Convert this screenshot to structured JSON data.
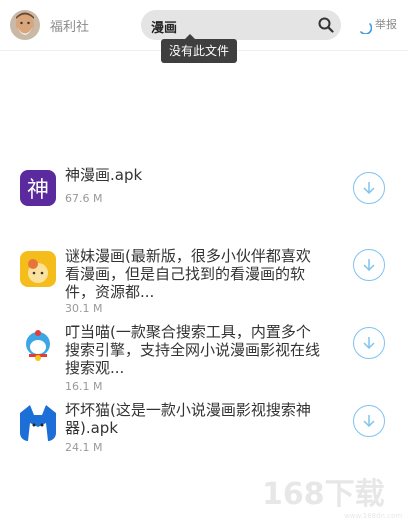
{
  "header": {
    "site_name": "福利社",
    "search_value": "漫画",
    "report_label": "举报"
  },
  "tooltip": "没有此文件",
  "items": [
    {
      "name": "神漫画.apk",
      "size": "67.6 M",
      "icon": "shen-manhua-app-icon",
      "color": "#5b2a9e"
    },
    {
      "name": "谜妹漫画(最新版，很多小伙伴都喜欢看漫画，但是自己找到的看漫画的软件，资源都...",
      "size": "30.1 M",
      "icon": "mimei-manhua-app-icon",
      "color": "#f5bd1c"
    },
    {
      "name": "叮当喵(一款聚合搜索工具，内置多个搜索引擎，支持全网小说漫画影视在线搜索观...",
      "size": "16.1 M",
      "icon": "dingdang-miao-app-icon",
      "color": "#3da7e6"
    },
    {
      "name": "坏坏猫(这是一款小说漫画影视搜索神器).apk",
      "size": "24.1 M",
      "icon": "huaihuai-mao-app-icon",
      "color": "#1d6fd8"
    }
  ],
  "watermark": {
    "text": "168下载",
    "subtext": "www.168dn.com"
  }
}
